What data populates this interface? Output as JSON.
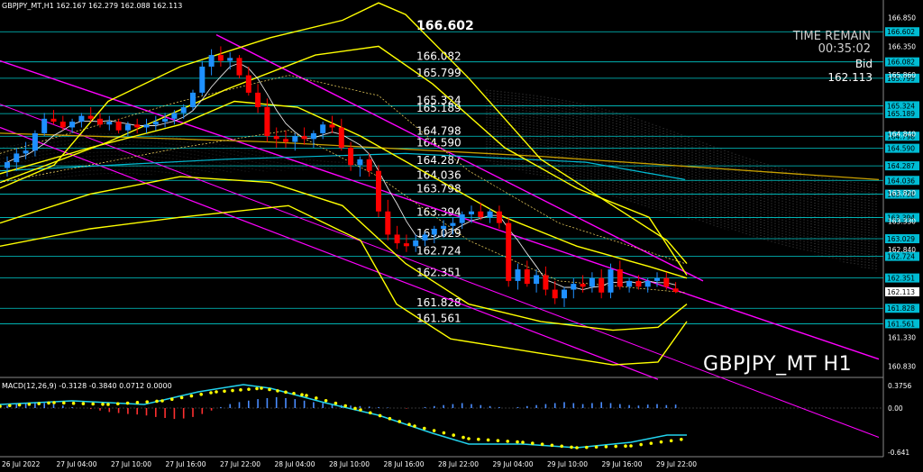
{
  "header": {
    "symbol_info": "GBPJPY_MT,H1",
    "ohlc": "162.167 162.279 162.088 162.113"
  },
  "timer": {
    "title": "TIME REMAIN",
    "value": "00:35:02"
  },
  "bid": {
    "label": "Bid",
    "value": "162.113"
  },
  "symbol_watermark": "GBPJPY_MT H1",
  "macd": {
    "label": "MACD(12,26,9) -0.3128 -0.3840 0.0712 0.0000",
    "axis_labels": [
      "0.3756",
      "0.00",
      "-0.641"
    ]
  },
  "price_axis_labels": [
    "166.850",
    "166.350",
    "165.860",
    "164.840",
    "163.820",
    "163.330",
    "162.840",
    "161.330",
    "160.830"
  ],
  "level_labels": [
    {
      "text": "166.602",
      "price": 166.602,
      "highlight": true
    },
    {
      "text": "166.082",
      "price": 166.082
    },
    {
      "text": "165.799",
      "price": 165.799
    },
    {
      "text": "165.324",
      "price": 165.324
    },
    {
      "text": "165.189",
      "price": 165.189
    },
    {
      "text": "164.798",
      "price": 164.798
    },
    {
      "text": "164.590",
      "price": 164.59
    },
    {
      "text": "164.287",
      "price": 164.287
    },
    {
      "text": "164.036",
      "price": 164.036
    },
    {
      "text": "163.798",
      "price": 163.798
    },
    {
      "text": "163.394",
      "price": 163.394
    },
    {
      "text": "163.029",
      "price": 163.029
    },
    {
      "text": "162.724",
      "price": 162.724
    },
    {
      "text": "162.351",
      "price": 162.351
    },
    {
      "text": "161.828",
      "price": 161.828
    },
    {
      "text": "161.561",
      "price": 161.561
    }
  ],
  "current_price_label": "162.113",
  "time_labels": [
    "26 Jul 2022",
    "27 Jul 04:00",
    "27 Jul 10:00",
    "27 Jul 16:00",
    "27 Jul 22:00",
    "28 Jul 04:00",
    "28 Jul 10:00",
    "28 Jul 16:00",
    "28 Jul 22:00",
    "29 Jul 04:00",
    "29 Jul 10:00",
    "29 Jul 16:00",
    "29 Jul 22:00"
  ],
  "colors": {
    "background": "#000000",
    "bull": "#1e90ff",
    "bear": "#ff0000",
    "band": "#ffff00",
    "channel": "#ff00ff",
    "level": "#00cccc",
    "ma_slow": "#c8a000",
    "ma_fast": "#00bcd4"
  },
  "chart_data": {
    "type": "candlestick",
    "symbol": "GBPJPY_MT",
    "timeframe": "H1",
    "candles": [
      [
        164.25,
        164.45,
        164.1,
        164.35
      ],
      [
        164.35,
        164.6,
        164.2,
        164.5
      ],
      [
        164.5,
        164.7,
        164.4,
        164.55
      ],
      [
        164.55,
        164.9,
        164.45,
        164.85
      ],
      [
        164.85,
        165.2,
        164.8,
        165.1
      ],
      [
        165.1,
        165.25,
        165.0,
        165.05
      ],
      [
        165.05,
        165.15,
        164.9,
        164.95
      ],
      [
        164.95,
        165.1,
        164.85,
        165.05
      ],
      [
        165.05,
        165.2,
        164.95,
        165.15
      ],
      [
        165.15,
        165.3,
        165.05,
        165.1
      ],
      [
        165.1,
        165.2,
        164.95,
        165.0
      ],
      [
        165.0,
        165.15,
        164.9,
        165.05
      ],
      [
        165.05,
        165.1,
        164.85,
        164.9
      ],
      [
        164.9,
        165.05,
        164.8,
        165.0
      ],
      [
        165.0,
        165.1,
        164.85,
        164.95
      ],
      [
        164.95,
        165.1,
        164.85,
        165.0
      ],
      [
        165.0,
        165.15,
        164.9,
        165.05
      ],
      [
        165.05,
        165.2,
        164.95,
        165.1
      ],
      [
        165.1,
        165.25,
        165.0,
        165.2
      ],
      [
        165.2,
        165.35,
        165.1,
        165.3
      ],
      [
        165.3,
        165.6,
        165.25,
        165.55
      ],
      [
        165.55,
        166.1,
        165.5,
        166.0
      ],
      [
        166.0,
        166.3,
        165.85,
        166.2
      ],
      [
        166.2,
        166.35,
        166.0,
        166.1
      ],
      [
        166.1,
        166.25,
        165.95,
        166.15
      ],
      [
        166.15,
        166.2,
        165.8,
        165.85
      ],
      [
        165.85,
        166.0,
        165.5,
        165.55
      ],
      [
        165.55,
        165.7,
        165.2,
        165.3
      ],
      [
        165.3,
        165.45,
        164.7,
        164.8
      ],
      [
        164.8,
        164.95,
        164.6,
        164.75
      ],
      [
        164.75,
        164.9,
        164.6,
        164.7
      ],
      [
        164.7,
        164.85,
        164.55,
        164.8
      ],
      [
        164.8,
        164.95,
        164.65,
        164.75
      ],
      [
        164.75,
        164.9,
        164.6,
        164.85
      ],
      [
        164.85,
        165.05,
        164.75,
        165.0
      ],
      [
        165.0,
        165.15,
        164.85,
        164.95
      ],
      [
        164.95,
        165.1,
        164.55,
        164.6
      ],
      [
        164.6,
        164.7,
        164.2,
        164.3
      ],
      [
        164.3,
        164.45,
        164.1,
        164.4
      ],
      [
        164.4,
        164.5,
        164.1,
        164.2
      ],
      [
        164.2,
        164.3,
        163.4,
        163.5
      ],
      [
        163.5,
        163.7,
        163.0,
        163.1
      ],
      [
        163.1,
        163.25,
        162.85,
        162.95
      ],
      [
        162.95,
        163.1,
        162.8,
        162.9
      ],
      [
        162.9,
        163.1,
        162.8,
        163.0
      ],
      [
        163.0,
        163.15,
        162.9,
        163.1
      ],
      [
        163.1,
        163.25,
        162.95,
        163.2
      ],
      [
        163.2,
        163.35,
        163.05,
        163.25
      ],
      [
        163.25,
        163.4,
        163.1,
        163.3
      ],
      [
        163.3,
        163.5,
        163.2,
        163.45
      ],
      [
        163.45,
        163.6,
        163.3,
        163.5
      ],
      [
        163.5,
        163.65,
        163.35,
        163.4
      ],
      [
        163.4,
        163.55,
        163.3,
        163.5
      ],
      [
        163.5,
        163.6,
        163.2,
        163.3
      ],
      [
        163.3,
        163.4,
        162.2,
        162.3
      ],
      [
        162.3,
        162.6,
        162.15,
        162.5
      ],
      [
        162.5,
        162.65,
        162.2,
        162.25
      ],
      [
        162.25,
        162.5,
        162.1,
        162.4
      ],
      [
        162.4,
        162.55,
        162.05,
        162.15
      ],
      [
        162.15,
        162.3,
        161.9,
        162.0
      ],
      [
        162.0,
        162.2,
        161.85,
        162.15
      ],
      [
        162.15,
        162.35,
        162.0,
        162.25
      ],
      [
        162.25,
        162.4,
        162.1,
        162.2
      ],
      [
        162.2,
        162.45,
        162.1,
        162.35
      ],
      [
        162.35,
        162.5,
        162.0,
        162.1
      ],
      [
        162.1,
        162.6,
        162.0,
        162.5
      ],
      [
        162.5,
        162.65,
        162.15,
        162.2
      ],
      [
        162.2,
        162.35,
        162.1,
        162.3
      ],
      [
        162.3,
        162.4,
        162.15,
        162.2
      ],
      [
        162.2,
        162.35,
        162.1,
        162.3
      ],
      [
        162.3,
        162.45,
        162.2,
        162.35
      ],
      [
        162.35,
        162.45,
        162.15,
        162.2
      ],
      [
        162.17,
        162.28,
        162.09,
        162.11
      ]
    ]
  }
}
